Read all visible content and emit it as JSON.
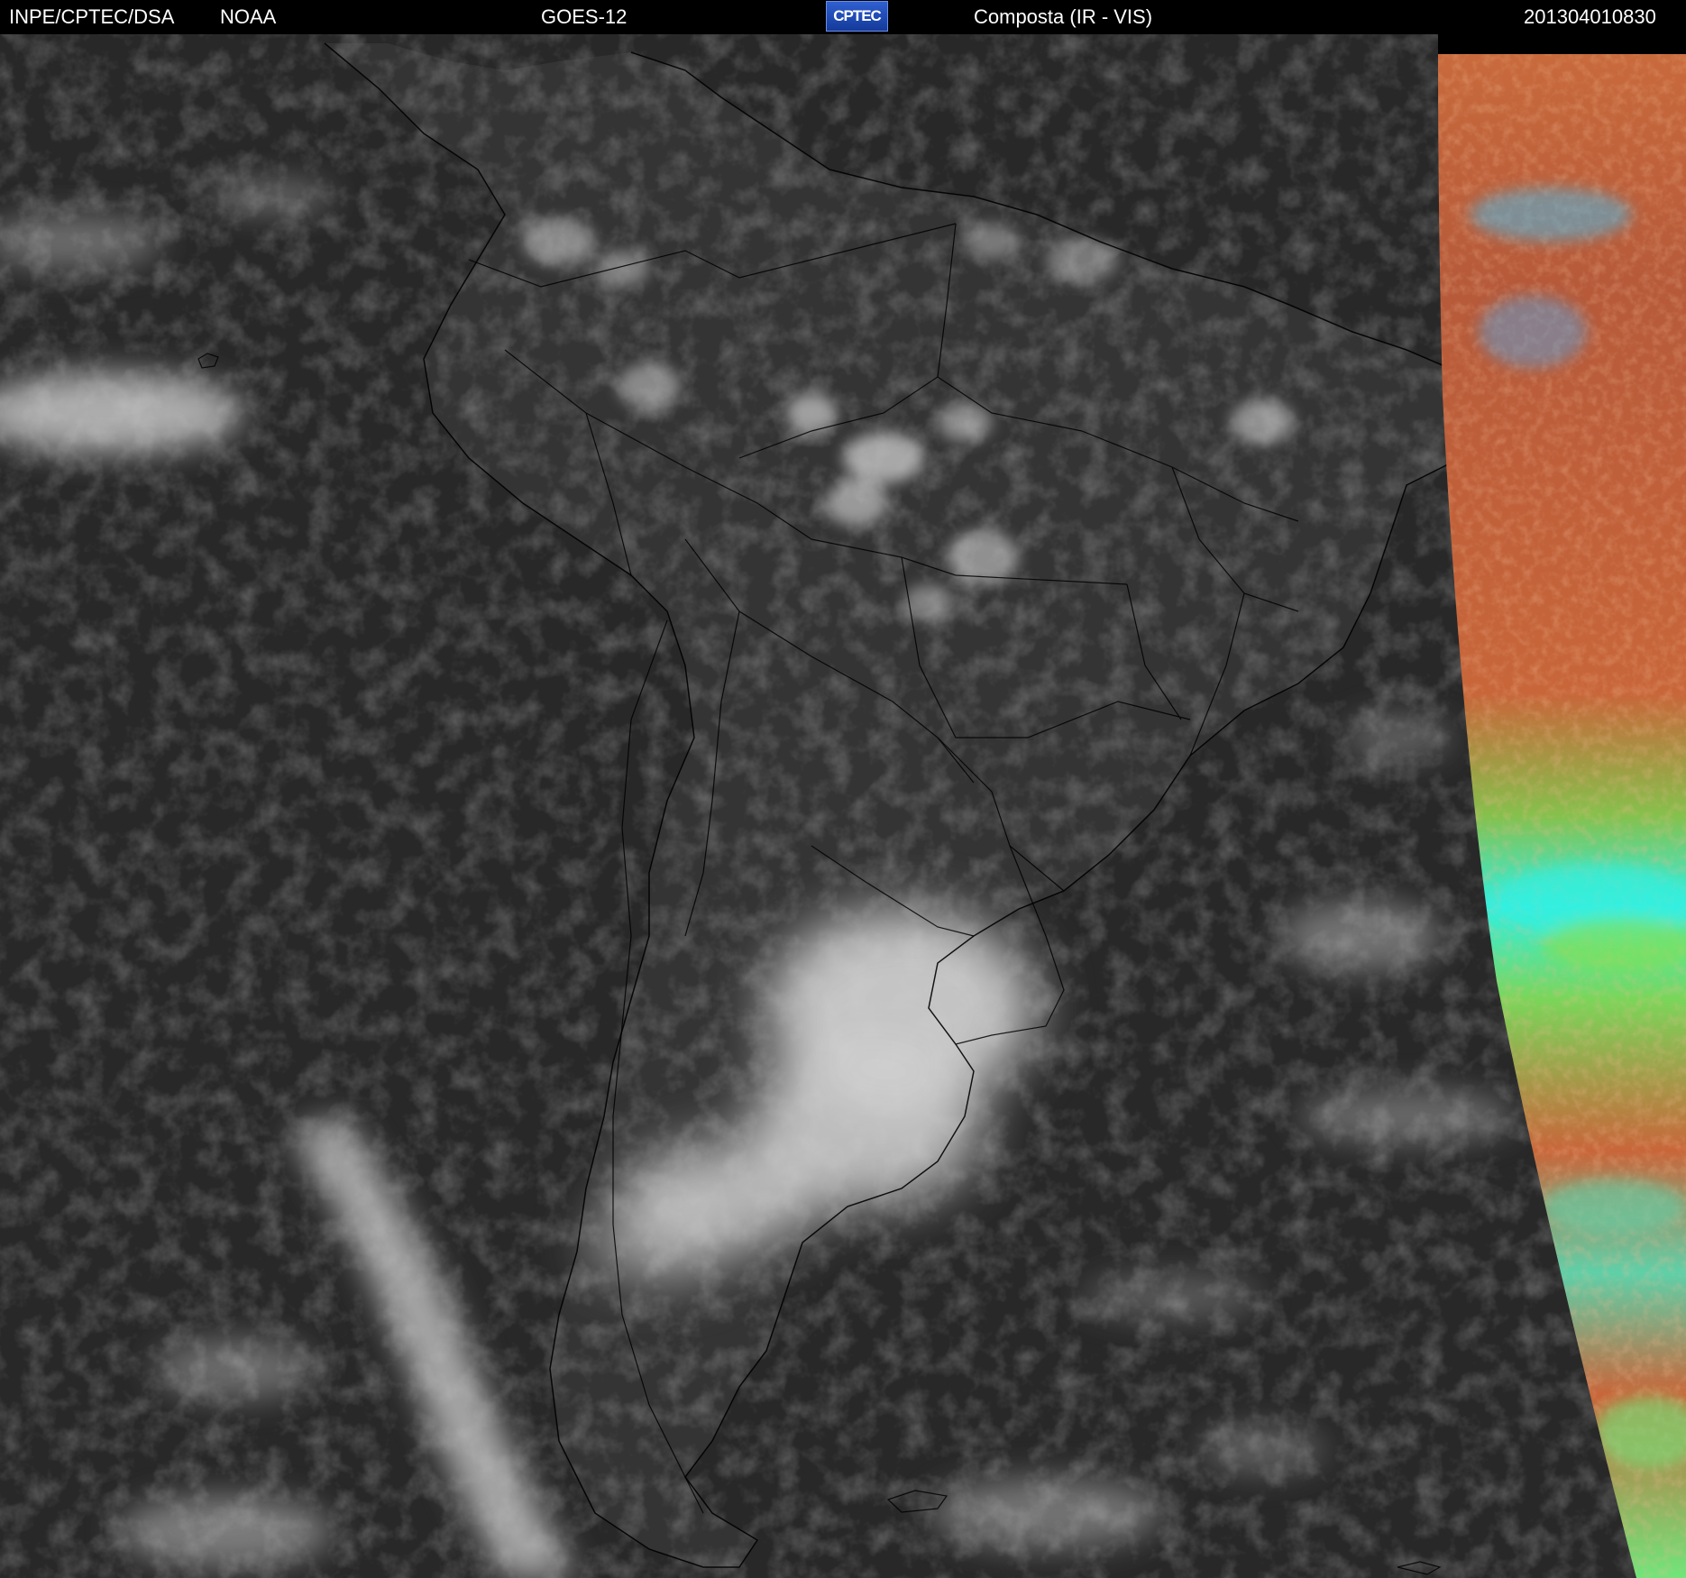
{
  "header": {
    "agency": "INPE/CPTEC/DSA",
    "source": "NOAA",
    "satellite": "GOES-12",
    "logo_text": "CPTEC",
    "product": "Composta (IR - VIS)",
    "timestamp": "201304010830"
  },
  "colors": {
    "background": "#000000",
    "ocean_gray": "#2e2e2e",
    "land_gray": "#343434",
    "cloud_white": "#d8d8d8",
    "coastline": "#000000",
    "vis_orange": "#c8663a",
    "vis_green": "#6fd46a",
    "vis_cyan": "#33f0e0",
    "vis_blue": "#5a86d8",
    "logo_blue": "#1f4db8"
  },
  "icons": {
    "logo": "cptec-logo"
  }
}
